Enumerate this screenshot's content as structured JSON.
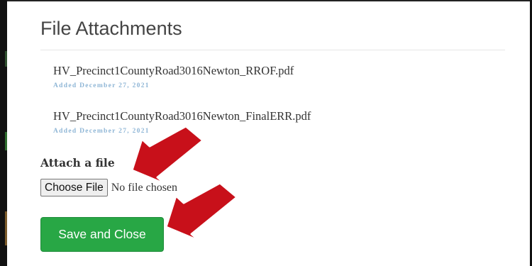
{
  "panel": {
    "title": "File Attachments"
  },
  "attachments": [
    {
      "name": "HV_Precinct1CountyRoad3016Newton_RROF.pdf",
      "added": "Added December 27, 2021"
    },
    {
      "name": "HV_Precinct1CountyRoad3016Newton_FinalERR.pdf",
      "added": "Added December 27, 2021"
    }
  ],
  "attach": {
    "label": "Attach a file",
    "choose_button": "Choose File",
    "no_file_text": "No file chosen"
  },
  "actions": {
    "save_close": "Save and Close"
  },
  "colors": {
    "accent_green": "#28a745",
    "date_blue": "#8fb6d6",
    "annotation_red": "#c8101a"
  },
  "annotations": [
    "arrow-icon",
    "arrow-icon"
  ]
}
